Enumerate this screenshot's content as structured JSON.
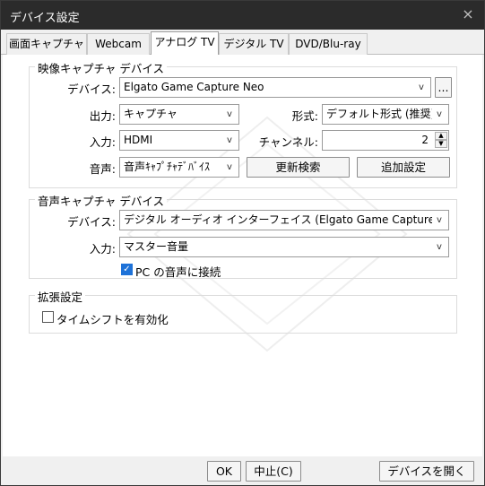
{
  "window": {
    "title": "デバイス設定",
    "close_glyph": "×"
  },
  "tabs": [
    {
      "label": "画面キャプチャ"
    },
    {
      "label": "Webcam"
    },
    {
      "label": "アナログ TV"
    },
    {
      "label": "デジタル TV"
    },
    {
      "label": "DVD/Blu-ray"
    }
  ],
  "video_group": {
    "title": "映像キャプチャ デバイス",
    "device_label": "デバイス:",
    "device_value": "Elgato Game Capture Neo",
    "browse_label": "...",
    "output_label": "出力:",
    "output_value": "キャプチャ",
    "format_label": "形式:",
    "format_value": "デフォルト形式 (推奨)",
    "input_label": "入力:",
    "input_value": "HDMI",
    "channel_label": "チャンネル:",
    "channel_value": "2",
    "audio_label": "音声:",
    "audio_value": "音声ｷｬﾌﾟﾁｬﾃﾞﾊﾞｲｽ",
    "refresh_label": "更新検索",
    "advanced_label": "追加設定"
  },
  "audio_group": {
    "title": "音声キャプチャ デバイス",
    "device_label": "デバイス:",
    "device_value": "デジタル オーディオ インターフェイス (Elgato Game Capture Neo)",
    "input_label": "入力:",
    "input_value": "マスター音量",
    "connect_label": "PC の音声に接続"
  },
  "ext_group": {
    "title": "拡張設定",
    "timeshift_label": "タイムシフトを有効化"
  },
  "footer": {
    "ok_label": "OK",
    "cancel_label": "中止(C)",
    "open_device_label": "デバイスを開く(O)"
  },
  "icons": {
    "combo_arrow": "v",
    "spin_up": "▲",
    "spin_down": "▼",
    "check": "✓"
  },
  "colors": {
    "titlebar": "#2b2b2b",
    "accent": "#1e72d8"
  }
}
